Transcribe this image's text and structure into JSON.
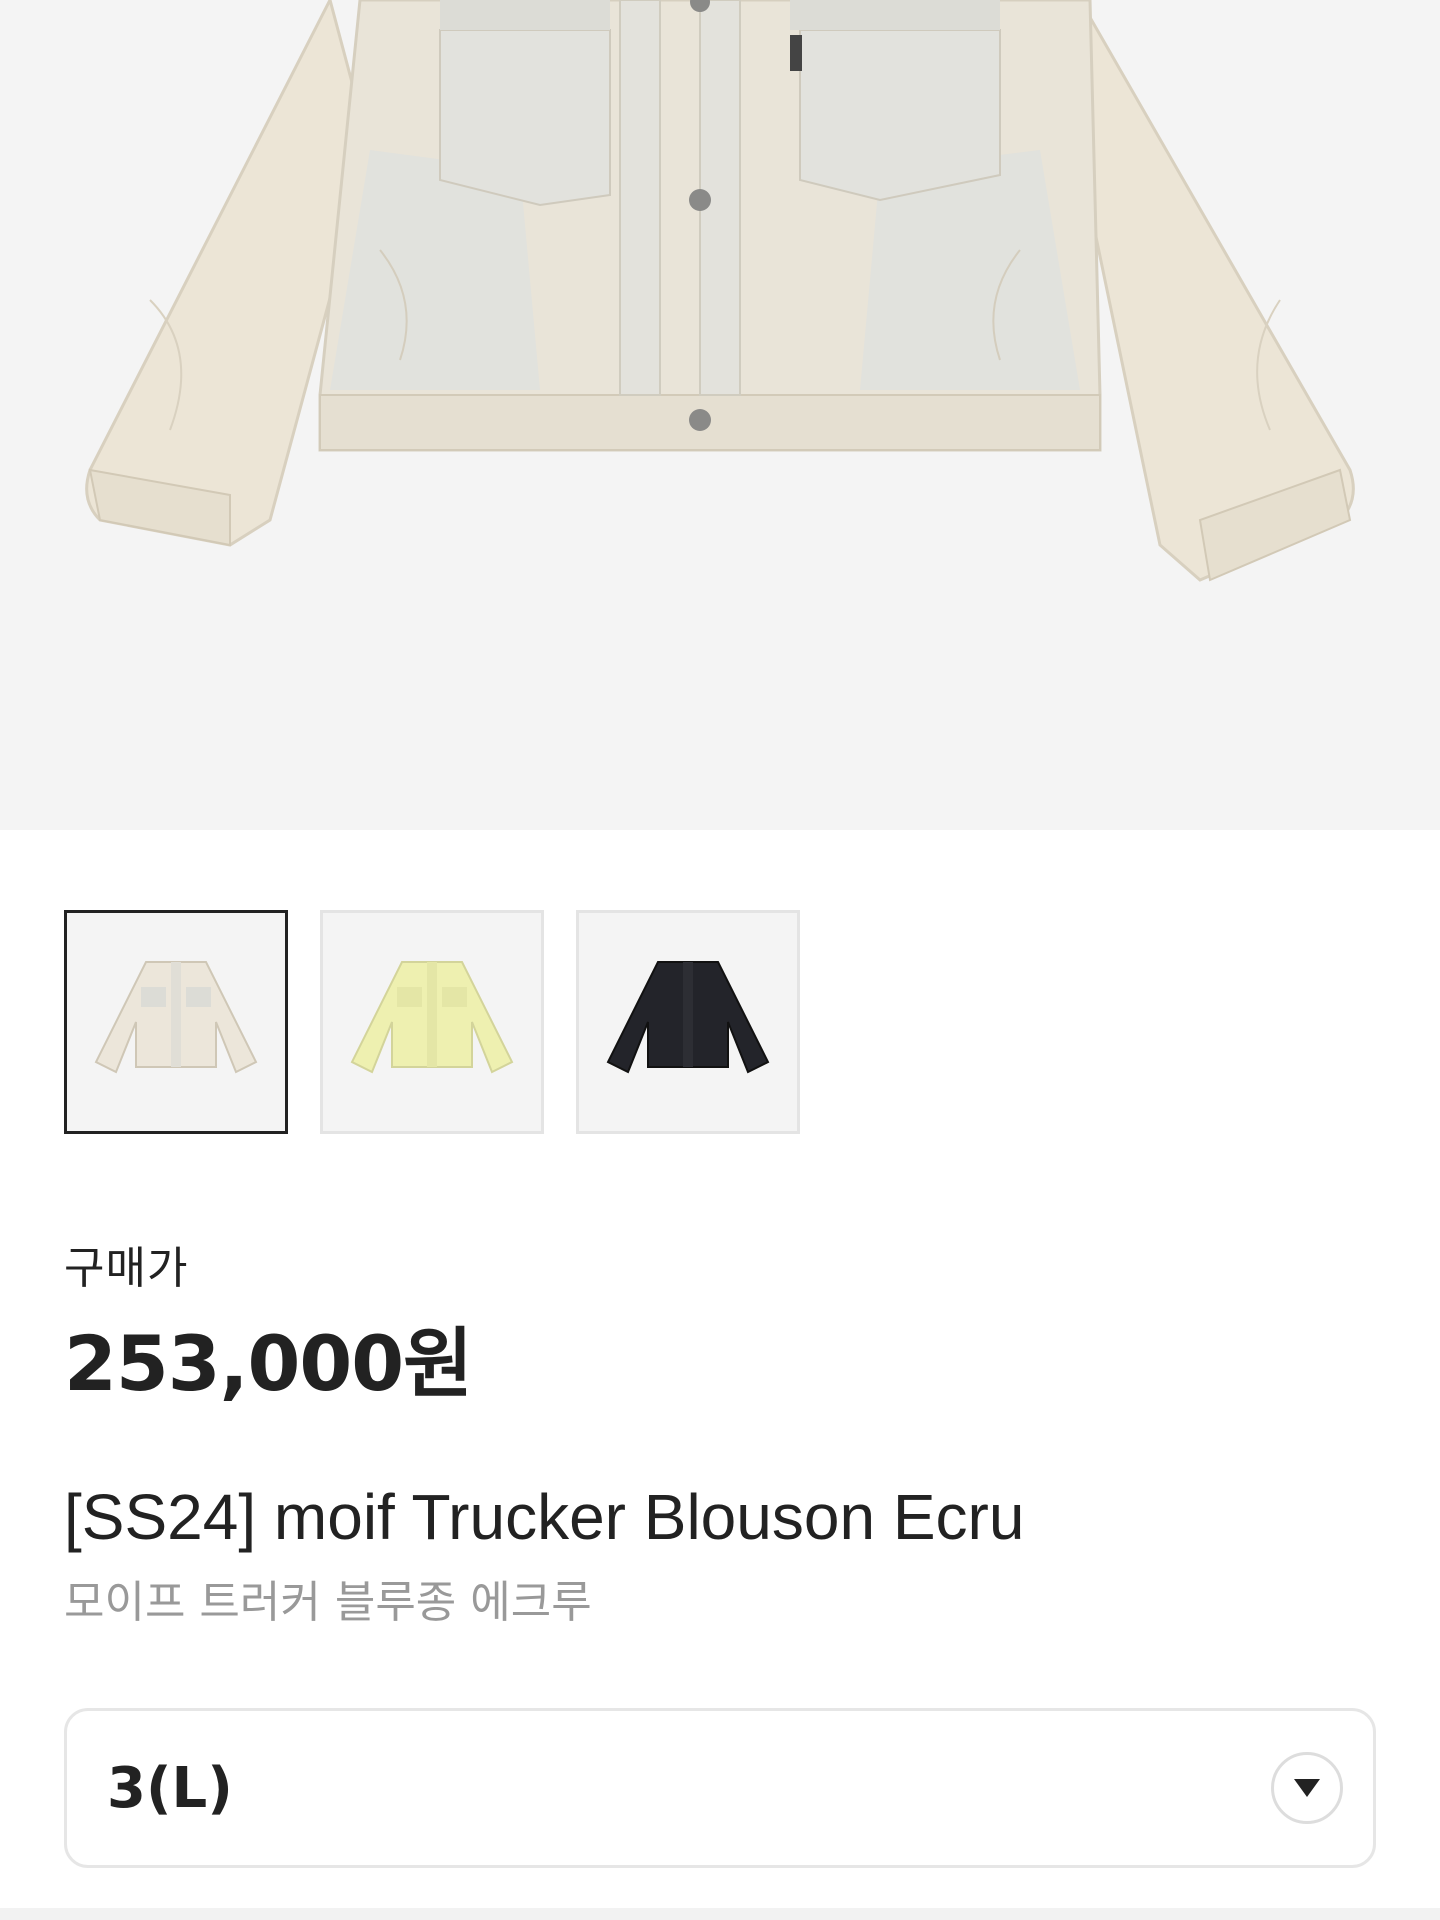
{
  "hero": {
    "image_icon": "ecru-trucker-jacket-photo"
  },
  "thumbnails": [
    {
      "icon": "ecru-jacket-thumbnail",
      "color": "#ece6da",
      "selected": true
    },
    {
      "icon": "yellow-jacket-thumbnail",
      "color": "#eef0b0",
      "selected": false
    },
    {
      "icon": "black-jacket-thumbnail",
      "color": "#23242a",
      "selected": false
    }
  ],
  "price": {
    "label": "구매가",
    "value": "253,000원"
  },
  "product": {
    "title": "[SS24] moif Trucker Blouson Ecru",
    "subtitle": "모이프 트러커 블루종 에크루"
  },
  "size_select": {
    "value": "3(L)",
    "icon": "chevron-down-icon"
  }
}
